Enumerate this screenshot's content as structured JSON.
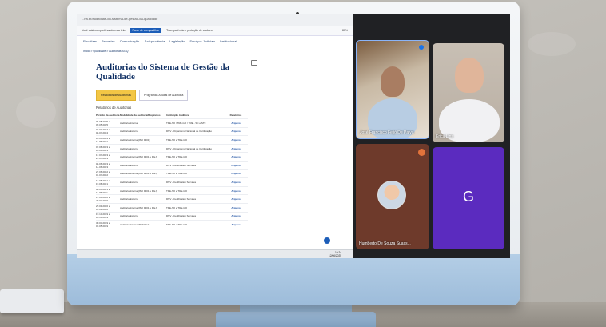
{
  "browser": {
    "url": "...ria.br/auditorias-do-sistema-de-gestao-da-qualidade",
    "infobar": {
      "text": "Você está compartilhando esta tela",
      "share_button": "Parar de compartilhar",
      "transparency": "Transparência e proteção de cookies"
    },
    "zoom": "80%",
    "nav": [
      "Fiscalizar",
      "Parcerias",
      "Comunicação",
      "Jurisprudência",
      "Legislação",
      "Serviços Judiciais",
      "Institucional"
    ],
    "breadcrumb": "Início > Qualidade > Auditorias SGQ",
    "page_title": "Auditorias do Sistema de Gestão da Qualidade",
    "tabs": [
      "Relatórios de Auditorias",
      "Programas Anuais de Auditoria"
    ],
    "section_title": "Relatórios de Auditorias",
    "table": {
      "headers": [
        "Período da Auditoria",
        "Modalidade da auditoria/Requisitos",
        "Instituição Auditora",
        "Relatórios"
      ],
      "rows": [
        [
          "05.05.2025 a 09.05.2025",
          "Auditoria Interna",
          "TRE-TO / TRE-GO / TRE - SC e STF",
          "Arquivo"
        ],
        [
          "07.07.2024 a 08.07.2024",
          "Auditoria Externa",
          "DNV - Organismo Nacional de Certificação",
          "Arquivo"
        ],
        [
          "10.06.2024 a 11.06.2024",
          "Auditoria Interna (ISO 9001)",
          "TRE-TO e TRE-GO",
          "Arquivo"
        ],
        [
          "07.08.2023 a 10.08.2023",
          "Auditoria Externa",
          "DNV - Organismo Nacional de Certificação",
          "Arquivo"
        ],
        [
          "17.07.2023 a 21.07.2023",
          "Auditoria Interna (ISO 9001 e PGJ)",
          "TRE-TO e TRE-GO",
          "Arquivo"
        ],
        [
          "08.06.2023 a 14.06.2023",
          "Auditoria Externa",
          "DNV - Certification Services",
          "Arquivo"
        ],
        [
          "27.06.2022 a 01.07.2022",
          "Auditoria Interna (ISO 9001 e PGJ)",
          "TRE-TO e TRE-GO",
          "Arquivo"
        ],
        [
          "17.08.2021 a 19.08.2021",
          "Auditoria Externa",
          "DNV - Certification Services",
          "Arquivo"
        ],
        [
          "08.06.2021 a 11.06.2021",
          "Auditoria Interna (ISO 9001 e PGJ)",
          "TRE-TO e TRE-GO",
          "Arquivo"
        ],
        [
          "17.03.2020 a 20.03.2020",
          "Auditoria Externa",
          "DNV - Certification Services",
          "Arquivo"
        ],
        [
          "29.01.2020 a 03.01.2020",
          "Auditoria Interna (ISO 9001 e PGJ)",
          "TRE-TO e TRE-GO",
          "Arquivo"
        ],
        [
          "19.10.2019 a 18.10.2019",
          "Auditoria Externa",
          "DNV - Certification Services",
          "Arquivo"
        ],
        [
          "30.04.2019 a 03.05.2019",
          "Auditoria Interna 2019 PGJ",
          "TRE-TO e TRE-GO",
          "Arquivo"
        ]
      ]
    },
    "clock": {
      "time": "10:24",
      "date": "12/06/2025"
    }
  },
  "call": {
    "participants": [
      {
        "name": "José Francisco Feijó De Paiva"
      },
      {
        "name": "Erica Lins"
      },
      {
        "name": "Humberto De Souza Suass..."
      },
      {
        "name": "",
        "initial": "G"
      }
    ]
  },
  "colors": {
    "accent_tab": "#f3c645",
    "link": "#1c4fa0",
    "call_tile_purple": "#5b2bbf"
  }
}
